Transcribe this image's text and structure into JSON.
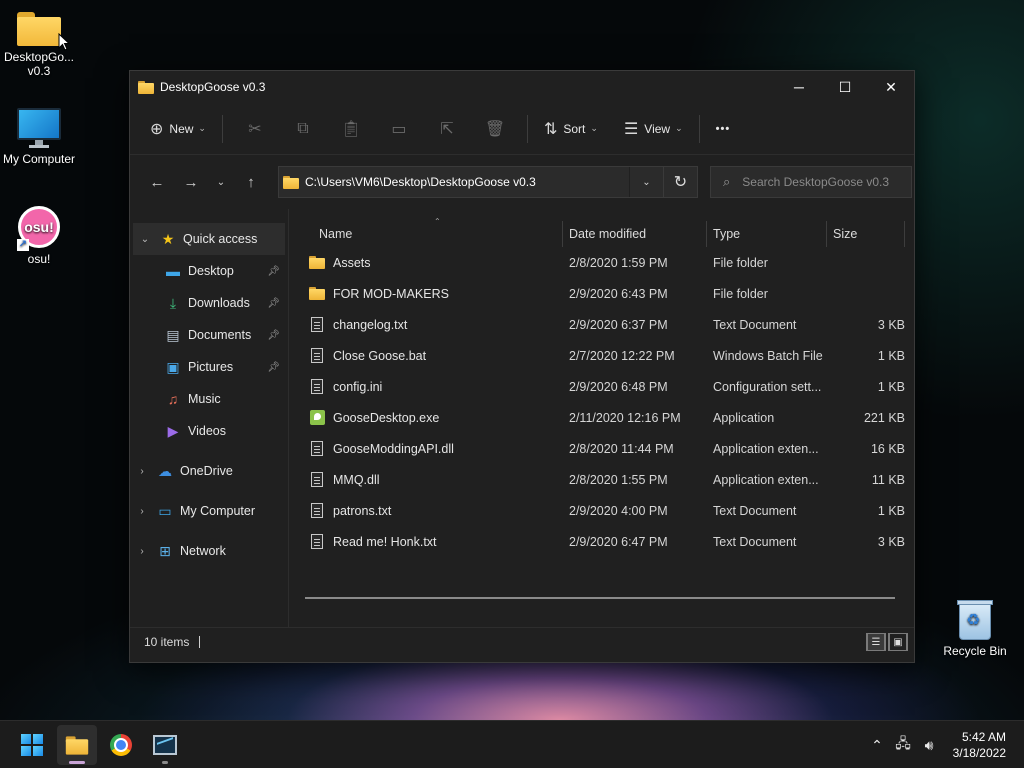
{
  "desktop": {
    "icons": [
      {
        "label": "DesktopGo... v0.3",
        "icon": "folder-icon"
      },
      {
        "label": "My Computer",
        "icon": "monitor-icon"
      },
      {
        "label": "osu!",
        "icon": "osu-icon",
        "glyph": "osu!"
      },
      {
        "label": "Recycle Bin",
        "icon": "recycle-bin-icon"
      }
    ]
  },
  "window": {
    "title": "DesktopGoose v0.3",
    "controls": {
      "minimize": "─",
      "maximize": "☐",
      "close": "✕"
    },
    "toolbar": {
      "new_label": "New",
      "sort_label": "Sort",
      "view_label": "View",
      "more_label": "•••"
    },
    "address": {
      "path": "C:\\Users\\VM6\\Desktop\\DesktopGoose v0.3"
    },
    "search": {
      "placeholder": "Search DesktopGoose v0.3"
    },
    "sidebar": {
      "quick_access": "Quick access",
      "items": [
        {
          "label": "Desktop",
          "pinned": true
        },
        {
          "label": "Downloads",
          "pinned": true
        },
        {
          "label": "Documents",
          "pinned": true
        },
        {
          "label": "Pictures",
          "pinned": true
        },
        {
          "label": "Music",
          "pinned": false
        },
        {
          "label": "Videos",
          "pinned": false
        }
      ],
      "onedrive": "OneDrive",
      "my_computer": "My Computer",
      "network": "Network"
    },
    "columns": {
      "name": "Name",
      "date": "Date modified",
      "type": "Type",
      "size": "Size"
    },
    "files": [
      {
        "name": "Assets",
        "date": "2/8/2020 1:59 PM",
        "type": "File folder",
        "size": "",
        "icon": "folder-icon"
      },
      {
        "name": "FOR MOD-MAKERS",
        "date": "2/9/2020 6:43 PM",
        "type": "File folder",
        "size": "",
        "icon": "folder-icon"
      },
      {
        "name": "changelog.txt",
        "date": "2/9/2020 6:37 PM",
        "type": "Text Document",
        "size": "3 KB",
        "icon": "text-file-icon"
      },
      {
        "name": "Close Goose.bat",
        "date": "2/7/2020 12:22 PM",
        "type": "Windows Batch File",
        "size": "1 KB",
        "icon": "batch-file-icon"
      },
      {
        "name": "config.ini",
        "date": "2/9/2020 6:48 PM",
        "type": "Configuration sett...",
        "size": "1 KB",
        "icon": "config-file-icon"
      },
      {
        "name": "GooseDesktop.exe",
        "date": "2/11/2020 12:16 PM",
        "type": "Application",
        "size": "221 KB",
        "icon": "exe-icon"
      },
      {
        "name": "GooseModdingAPI.dll",
        "date": "2/8/2020 11:44 PM",
        "type": "Application exten...",
        "size": "16 KB",
        "icon": "dll-file-icon"
      },
      {
        "name": "MMQ.dll",
        "date": "2/8/2020 1:55 PM",
        "type": "Application exten...",
        "size": "11 KB",
        "icon": "dll-file-icon"
      },
      {
        "name": "patrons.txt",
        "date": "2/9/2020 4:00 PM",
        "type": "Text Document",
        "size": "1 KB",
        "icon": "text-file-icon"
      },
      {
        "name": "Read me! Honk.txt",
        "date": "2/9/2020 6:47 PM",
        "type": "Text Document",
        "size": "3 KB",
        "icon": "text-file-icon"
      }
    ],
    "status": {
      "item_count": "10 items"
    }
  },
  "taskbar": {
    "time": "5:42 AM",
    "date": "3/18/2022"
  }
}
